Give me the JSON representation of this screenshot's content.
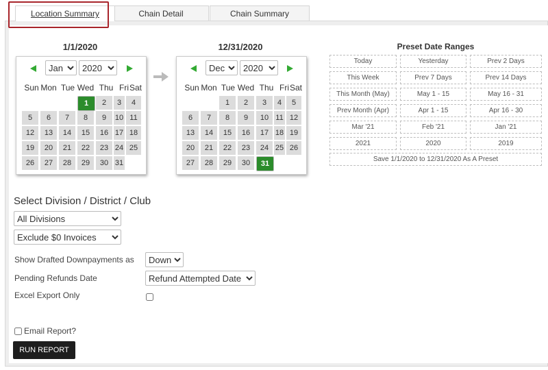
{
  "tabs": [
    {
      "label": "Location Summary",
      "active": true
    },
    {
      "label": "Chain Detail",
      "active": false
    },
    {
      "label": "Chain Summary",
      "active": false
    }
  ],
  "start_calendar": {
    "title": "1/1/2020",
    "month": "Jan",
    "year": "2020",
    "selected_day": "1",
    "days": [
      "1",
      "2",
      "3",
      "4",
      "5",
      "6",
      "7",
      "8",
      "9",
      "10",
      "11",
      "12",
      "13",
      "14",
      "15",
      "16",
      "17",
      "18",
      "19",
      "20",
      "21",
      "22",
      "23",
      "24",
      "25",
      "26",
      "27",
      "28",
      "29",
      "30",
      "31"
    ]
  },
  "end_calendar": {
    "title": "12/31/2020",
    "month": "Dec",
    "year": "2020",
    "selected_day": "31",
    "days": [
      "1",
      "2",
      "3",
      "4",
      "5",
      "6",
      "7",
      "8",
      "9",
      "10",
      "11",
      "12",
      "13",
      "14",
      "15",
      "16",
      "17",
      "18",
      "19",
      "20",
      "21",
      "22",
      "23",
      "24",
      "25",
      "26",
      "27",
      "28",
      "29",
      "30",
      "31"
    ]
  },
  "weekdays": [
    "Sun",
    "Mon",
    "Tue",
    "Wed",
    "Thu",
    "Fri",
    "Sat"
  ],
  "presets": {
    "title": "Preset Date Ranges",
    "rows": [
      [
        "Today",
        "Yesterday",
        "Prev 2 Days"
      ],
      [
        "This Week",
        "Prev 7 Days",
        "Prev 14 Days"
      ],
      [
        "This Month (May)",
        "May 1 - 15",
        "May 16 - 31"
      ],
      [
        "Prev Month (Apr)",
        "Apr 1 - 15",
        "Apr 16 - 30"
      ],
      [
        "Mar '21",
        "Feb '21",
        "Jan '21"
      ],
      [
        "2021",
        "2020",
        "2019"
      ]
    ],
    "save_label": "Save 1/1/2020 to 12/31/2020 As A Preset"
  },
  "filters": {
    "section_title": "Select Division / District / Club",
    "division_value": "All Divisions",
    "invoice_value": "Exclude $0 Invoices",
    "downpayments_label": "Show Drafted Downpayments as",
    "downpayments_value": "Down",
    "refunds_label": "Pending Refunds Date",
    "refunds_value": "Refund Attempted Date",
    "excel_label": "Excel Export Only",
    "email_label": "Email Report?"
  },
  "run_button": "RUN REPORT",
  "colors": {
    "selected_day": "#2b8c2b",
    "nav_arrow": "#33aa33",
    "highlight_box": "#a8242a",
    "run_button": "#1e1e1e"
  }
}
